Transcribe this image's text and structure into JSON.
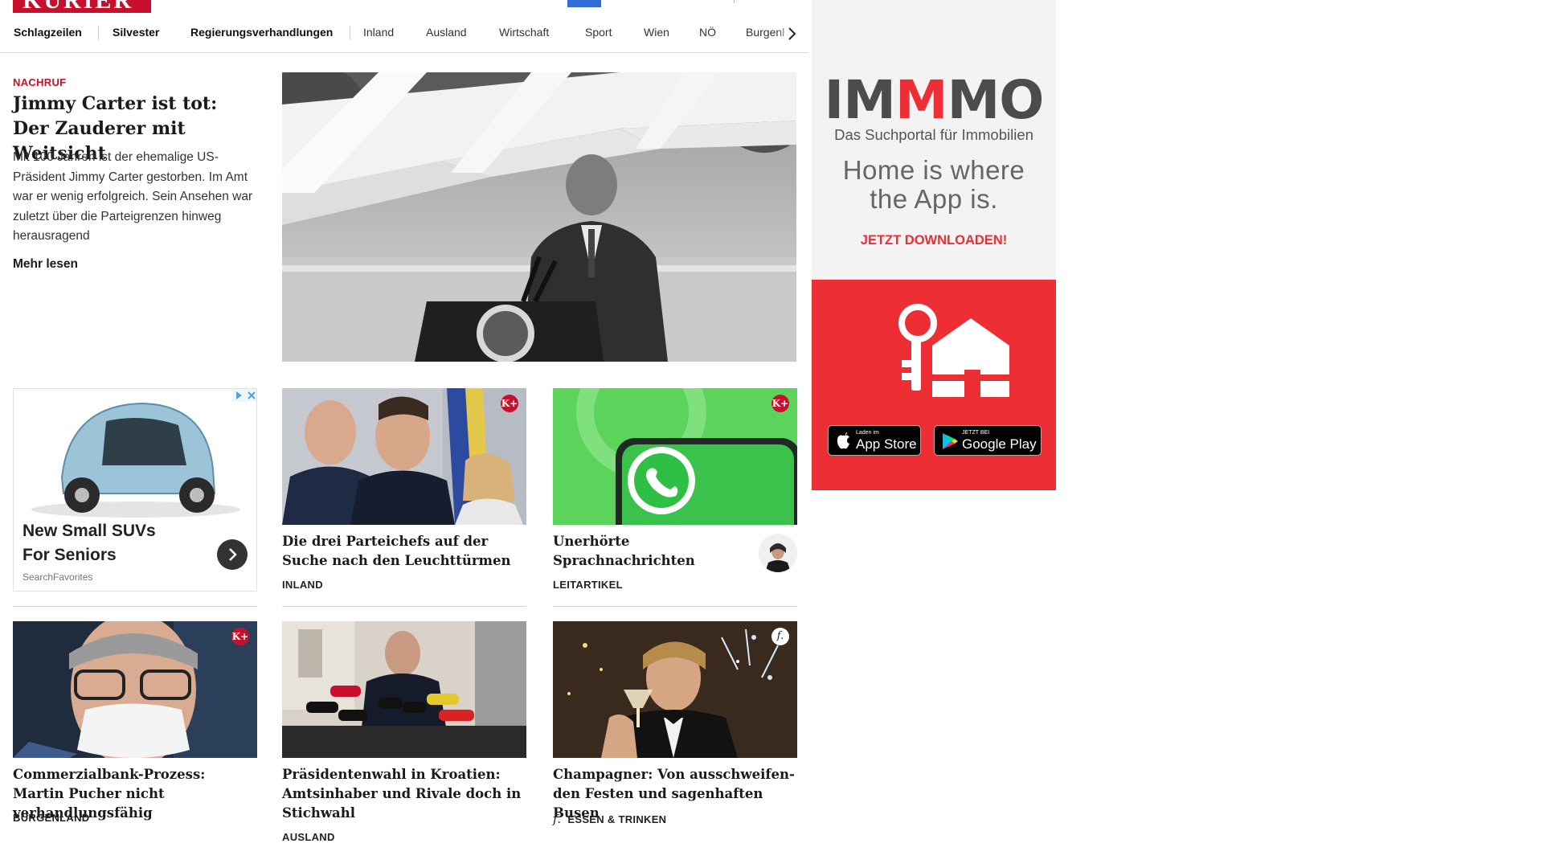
{
  "header": {
    "logo_text": "KURIER",
    "nav": {
      "items": [
        "Schlagzeilen",
        "Silvester",
        "Regierungsverhandlungen",
        "Inland",
        "Ausland",
        "Wirtschaft",
        "Sport",
        "Wien",
        "NÖ",
        "Burgenl"
      ]
    }
  },
  "lead": {
    "kicker": "NACHRUF",
    "title": "Jimmy Carter ist tot: Der Zauderer mit Weitsicht",
    "teaser": "Mit 100 Jahren ist der ehemalige US-Präsident Jimmy Carter gestorben. Im Amt war er wenig erfolgreich. Sein Ansehen war zuletzt über die Parteigrenzen hinweg herausragend",
    "more": "Mehr lesen"
  },
  "ad": {
    "title": "New Small SUVs For Seniors",
    "source": "SearchFavorites"
  },
  "cards": [
    {
      "title": "Die drei Parteichefs auf der Suche nach den Leuchttürmen",
      "category": "INLAND",
      "badge": "K+"
    },
    {
      "title": "Unerhörte Sprachnachrichten",
      "category": "LEITARTIKEL",
      "badge": "K+"
    },
    {
      "title": "Commerzialbank-Prozess: Martin Pucher nicht verhandlungsfähig",
      "category": "BURGENLAND",
      "badge": "K+"
    },
    {
      "title": "Präsidentenwahl in Kroatien: Amtsinhaber und Rivale doch in Stichwahl",
      "category": "AUSLAND"
    },
    {
      "title": "Champagner: Von ausschweifen-den Festen und sagenhaften Busen",
      "category": "ESSEN & TRINKEN",
      "badge": "f."
    }
  ],
  "banner": {
    "logo": "IMMMO",
    "subtitle": "Das Suchportal für Immobilien",
    "headline_line1": "Home is where",
    "headline_line2": "the App is.",
    "cta": "JETZT DOWNLOADEN!",
    "appstore_small": "Laden im",
    "appstore_big": "App Store",
    "googleplay_small": "JETZT BEI",
    "googleplay_big": "Google Play"
  },
  "colors": {
    "brand_red": "#c8102e",
    "immo_red": "#ee2e35",
    "nav_accent": "#2f6cd6"
  }
}
